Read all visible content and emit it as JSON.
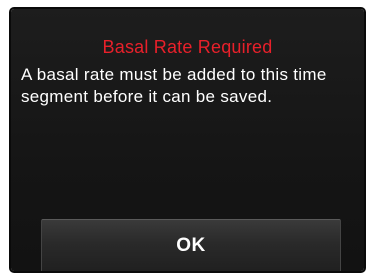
{
  "dialog": {
    "title": "Basal Rate Required",
    "message": "A basal rate must be added to this time segment before it can be saved.",
    "ok_label": "OK"
  },
  "colors": {
    "title": "#e8202a",
    "message": "#ffffff",
    "screen_background": "#151515",
    "button_background": "#2a2a2a"
  }
}
